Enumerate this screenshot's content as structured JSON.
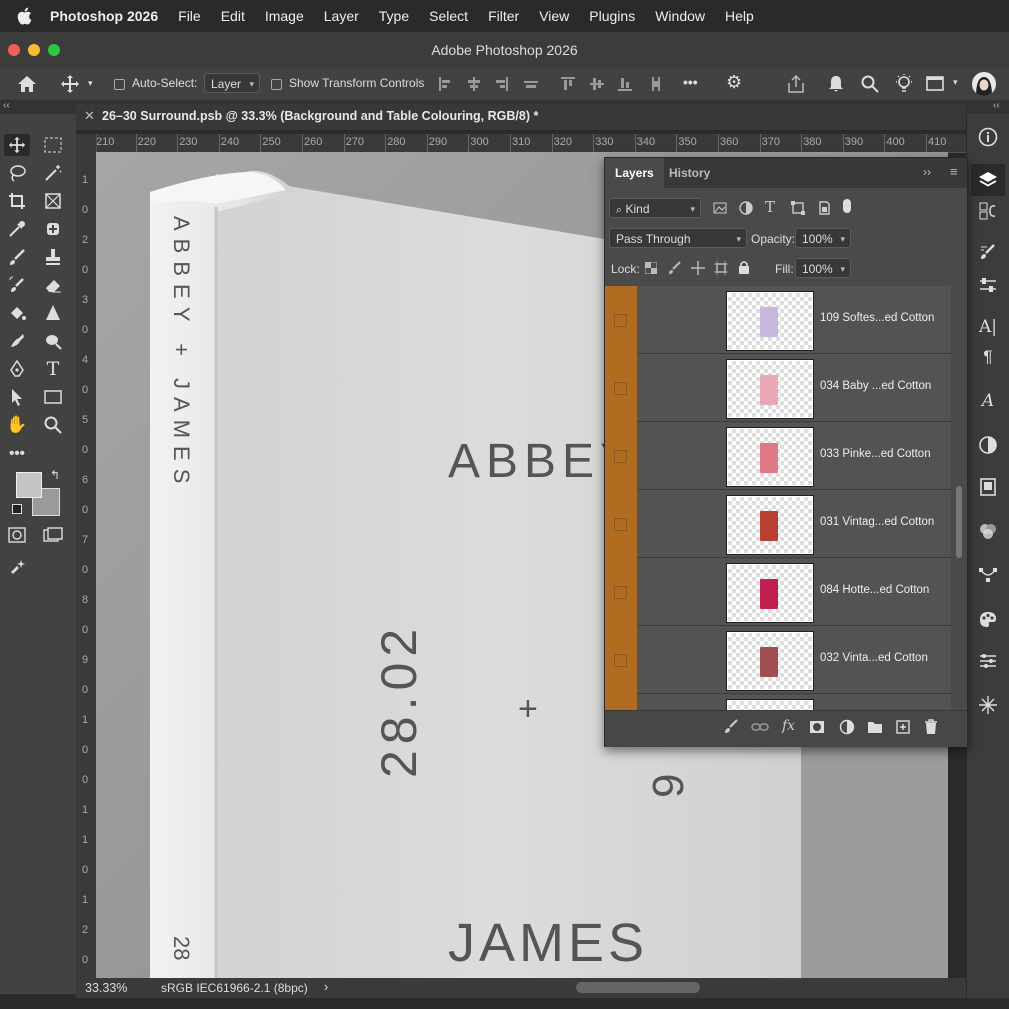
{
  "menubar": {
    "app": "Photoshop 2026",
    "items": [
      "File",
      "Edit",
      "Image",
      "Layer",
      "Type",
      "Select",
      "Filter",
      "View",
      "Plugins",
      "Window",
      "Help"
    ]
  },
  "window": {
    "title": "Adobe Photoshop 2026"
  },
  "options": {
    "auto_select_label": "Auto-Select:",
    "auto_select_value": "Layer",
    "show_transform_label": "Show Transform Controls",
    "more": "•••"
  },
  "document": {
    "tab_title": "26–30 Surround.psb @ 33.3% (Background and Table Colouring, RGB/8) *",
    "zoom": "33.33%",
    "profile": "sRGB IEC61966-2.1 (8bpc)",
    "status_arrow": "›"
  },
  "ruler": {
    "h_ticks": [
      "210",
      "220",
      "230",
      "240",
      "250",
      "260",
      "270",
      "280",
      "290",
      "300",
      "310",
      "320",
      "330",
      "340",
      "350",
      "360",
      "370",
      "380",
      "390",
      "400",
      "410"
    ],
    "v_ticks": [
      "1",
      "0",
      "2",
      "0",
      "3",
      "0",
      "4",
      "0",
      "5",
      "0",
      "6",
      "0",
      "7",
      "0",
      "8",
      "0",
      "9",
      "0",
      "1",
      "0",
      "0",
      "1",
      "1",
      "0",
      "1",
      "2",
      "0"
    ]
  },
  "canvas_text": {
    "spine": "ABBEY + JAMES",
    "cover_name": "ABBEY",
    "date": "28.02",
    "plus": "+",
    "bottom_name": "JAMES",
    "spine_bottom": "28",
    "edge_digit": "9"
  },
  "layers_panel": {
    "tabs": [
      "Layers",
      "History"
    ],
    "filter": "Kind",
    "blend_mode": "Pass Through",
    "opacity_label": "Opacity:",
    "opacity": "100%",
    "fill_label": "Fill:",
    "fill": "100%",
    "lock_label": "Lock:",
    "rows": [
      {
        "name": "109 Softes...ed Cotton",
        "color": "#c8b8e0"
      },
      {
        "name": "034 Baby ...ed Cotton",
        "color": "#e8a8b4"
      },
      {
        "name": "033 Pinke...ed Cotton",
        "color": "#e07888"
      },
      {
        "name": "031 Vintag...ed Cotton",
        "color": "#b84030"
      },
      {
        "name": "084 Hotte...ed Cotton",
        "color": "#c02050"
      },
      {
        "name": "032 Vinta...ed Cotton",
        "color": "#a05050"
      }
    ],
    "footer_icons": [
      "brush-icon",
      "link-icon",
      "fx-icon",
      "mask-icon",
      "adjustment-icon",
      "folder-icon",
      "new-layer-icon",
      "trash-icon"
    ]
  }
}
